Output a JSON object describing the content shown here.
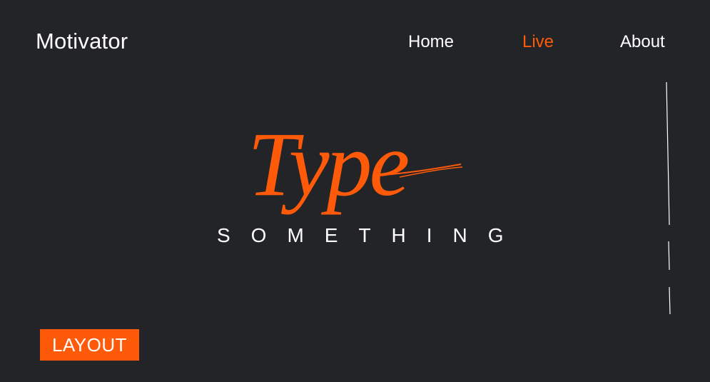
{
  "brand": {
    "name": "Motivator"
  },
  "nav": {
    "items": [
      {
        "label": "Home",
        "active": false
      },
      {
        "label": "Live",
        "active": true
      },
      {
        "label": "About",
        "active": false
      }
    ]
  },
  "hero": {
    "title": "Type",
    "subtitle": "SOMETHING"
  },
  "footer": {
    "layout_button_label": "LAYOUT"
  },
  "colors": {
    "background": "#232427",
    "accent": "#ff5a0a",
    "text": "#ffffff"
  }
}
